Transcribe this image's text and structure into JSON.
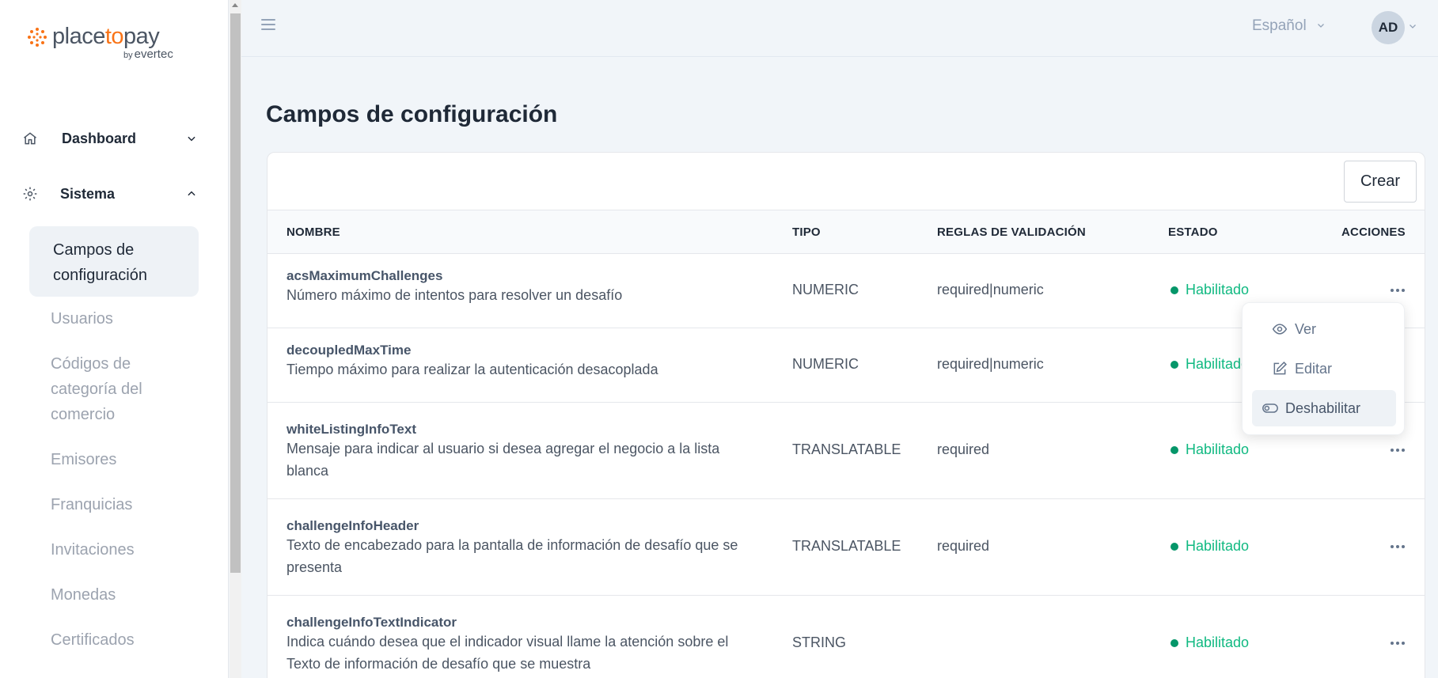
{
  "brand": {
    "logo_part1": "place",
    "logo_part2": "to",
    "logo_part3": "pay",
    "logo_by": "by",
    "logo_sub": "evertec",
    "accent": "#f97316"
  },
  "sidebar": {
    "groups": [
      {
        "label": "Dashboard",
        "icon": "home-icon"
      },
      {
        "label": "Sistema",
        "icon": "gear-icon"
      }
    ],
    "active_item": "Campos de configuración",
    "items": [
      "Usuarios",
      "Códigos de categoría del comercio",
      "Emisores",
      "Franquicias",
      "Invitaciones",
      "Monedas",
      "Certificados"
    ]
  },
  "header": {
    "language": "Español",
    "avatar_initials": "AD"
  },
  "main": {
    "title": "Campos de configuración",
    "create_label": "Crear",
    "columns": [
      "NOMBRE",
      "TIPO",
      "REGLAS DE VALIDACIÓN",
      "ESTADO",
      "ACCIONES"
    ],
    "rows": [
      {
        "name": "acsMaximumChallenges",
        "description": "Número máximo de intentos para resolver un desafío",
        "type": "NUMERIC",
        "rules": "required|numeric",
        "status": "Habilitado"
      },
      {
        "name": "decoupledMaxTime",
        "description": "Tiempo máximo para realizar la autenticación desacoplada",
        "type": "NUMERIC",
        "rules": "required|numeric",
        "status": "Habilitado"
      },
      {
        "name": "whiteListingInfoText",
        "description": "Mensaje para indicar al usuario si desea agregar el negocio a la lista blanca",
        "type": "TRANSLATABLE",
        "rules": "required",
        "status": "Habilitado"
      },
      {
        "name": "challengeInfoHeader",
        "description": "Texto de encabezado para la pantalla de información de desafío que se presenta",
        "type": "TRANSLATABLE",
        "rules": "required",
        "status": "Habilitado"
      },
      {
        "name": "challengeInfoTextIndicator",
        "description": "Indica cuándo desea que el indicador visual llame la atención sobre el Texto de información de desafío que se muestra",
        "type": "STRING",
        "rules": "",
        "status": "Habilitado"
      }
    ],
    "status_color": "#10b981"
  },
  "menu": {
    "items": [
      {
        "label": "Ver",
        "icon": "eye-icon"
      },
      {
        "label": "Editar",
        "icon": "edit-icon"
      },
      {
        "label": "Deshabilitar",
        "icon": "toggle-icon"
      }
    ]
  }
}
